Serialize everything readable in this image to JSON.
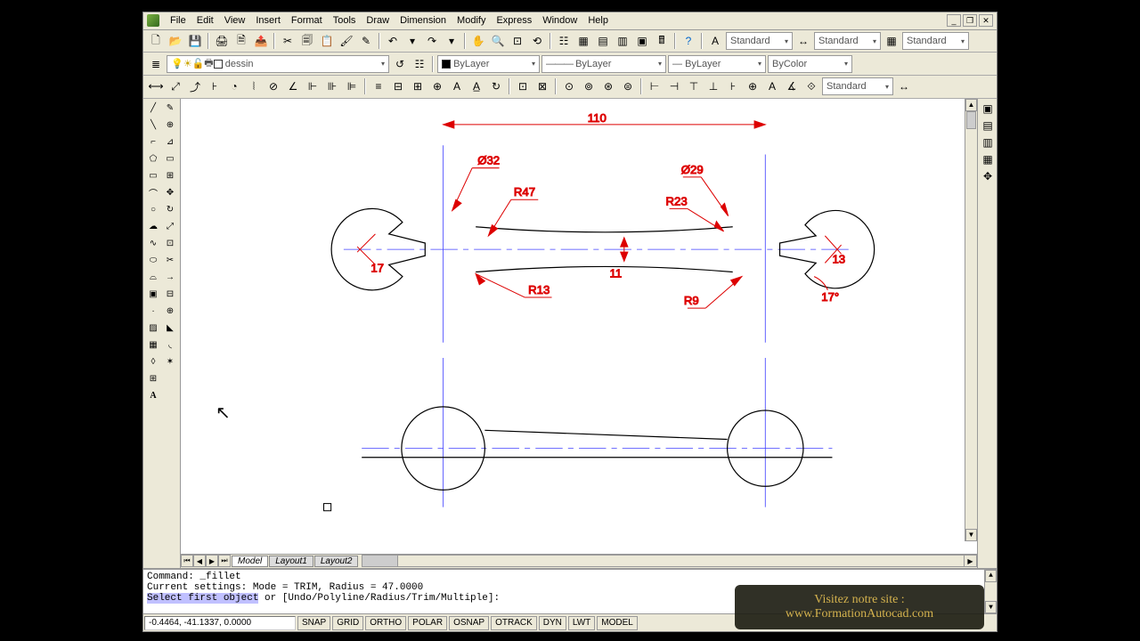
{
  "menus": [
    "File",
    "Edit",
    "View",
    "Insert",
    "Format",
    "Tools",
    "Draw",
    "Dimension",
    "Modify",
    "Express",
    "Window",
    "Help"
  ],
  "styles": {
    "text": "Standard",
    "dim": "Standard",
    "table": "Standard"
  },
  "layer": {
    "name": "dessin"
  },
  "linetype": {
    "by_layer1": "ByLayer",
    "by_layer2": "ByLayer",
    "by_color": "ByColor"
  },
  "dim_toolbar_style": "Standard",
  "sheet_tabs": [
    "Model",
    "Layout1",
    "Layout2"
  ],
  "command": {
    "line1": "Command: _fillet",
    "line2": "Current settings: Mode = TRIM, Radius = 47.0000",
    "prompt_highlight": "Select first object",
    "prompt_rest": " or [Undo/Polyline/Radius/Trim/Multiple]:"
  },
  "status": {
    "coords": "-0.4464, -41.1337, 0.0000",
    "toggles": [
      "SNAP",
      "GRID",
      "ORTHO",
      "POLAR",
      "OSNAP",
      "OTRACK",
      "DYN",
      "LWT",
      "MODEL"
    ]
  },
  "dimensions": {
    "overall": "110",
    "dia_left": "Ø32",
    "r47": "R47",
    "dia_right": "Ø29",
    "r23": "R23",
    "val17": "17",
    "val11": "11",
    "r13": "R13",
    "r9": "R9",
    "val13": "13",
    "ang17": "17°"
  },
  "banner": {
    "line1": "Visitez notre site :",
    "line2": "www.FormationAutocad.com"
  }
}
